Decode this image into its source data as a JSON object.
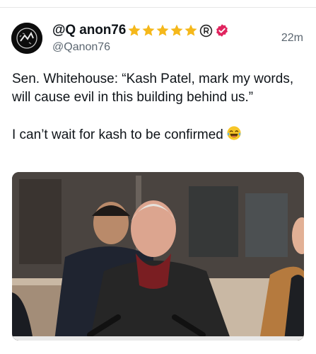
{
  "post": {
    "display_name": "@Q anon76",
    "handle": "@Qanon76",
    "time": "22m",
    "paragraphs": [
      "Sen. Whitehouse: “Kash Patel, mark my words, will cause evil in this building behind us.”",
      "I can’t wait for kash to be confirmed"
    ],
    "badges": [
      "star-icon",
      "star-icon",
      "star-icon",
      "star-icon",
      "star-icon",
      "registered-icon",
      "verified-icon"
    ],
    "emoji": "laughing-tears-emoji"
  },
  "media": {
    "type": "video-thumbnail",
    "description_icon": "video-frame"
  },
  "colors": {
    "star": "#f5b81b",
    "verified": "#e0245e",
    "handle": "#5b6670",
    "text": "#0f1419"
  }
}
